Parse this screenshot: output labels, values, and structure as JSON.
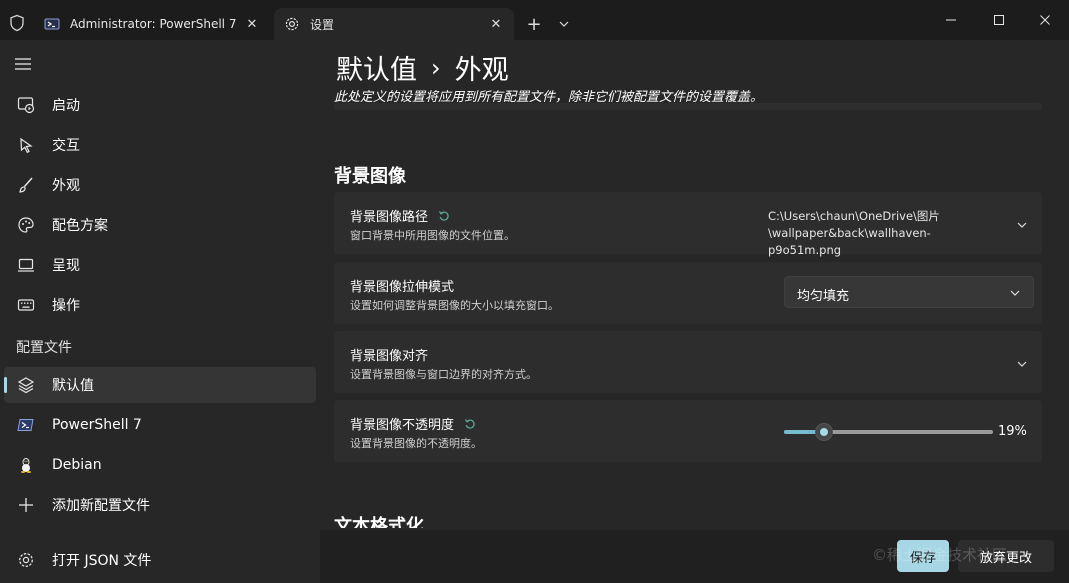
{
  "tabs": [
    {
      "label": "Administrator: PowerShell 7",
      "icon": "powershell-icon"
    },
    {
      "label": "设置",
      "icon": "gear-icon"
    }
  ],
  "sidebar": {
    "items": [
      {
        "label": "启动",
        "icon": "startup-icon"
      },
      {
        "label": "交互",
        "icon": "cursor-icon"
      },
      {
        "label": "外观",
        "icon": "brush-icon"
      },
      {
        "label": "配色方案",
        "icon": "palette-icon"
      },
      {
        "label": "呈现",
        "icon": "monitor-icon"
      },
      {
        "label": "操作",
        "icon": "keyboard-icon"
      }
    ],
    "profiles_header": "配置文件",
    "profiles": [
      {
        "label": "默认值",
        "icon": "layers-icon",
        "selected": true
      },
      {
        "label": "PowerShell 7",
        "icon": "powershell-icon"
      },
      {
        "label": "Debian",
        "icon": "linux-icon"
      },
      {
        "label": "添加新配置文件",
        "icon": "plus-icon"
      }
    ],
    "open_json": {
      "label": "打开 JSON 文件",
      "icon": "gear-icon"
    }
  },
  "main": {
    "breadcrumb": [
      "默认值",
      "外观"
    ],
    "breadcrumb_sep": "›",
    "subtitle": "此处定义的设置将应用到所有配置文件，除非它们被配置文件的设置覆盖。",
    "section_title": "背景图像",
    "cards": [
      {
        "title": "背景图像路径",
        "desc": "窗口背景中所用图像的文件位置。",
        "value_line1": "C:\\Users\\chaun\\OneDrive\\图片",
        "value_line2": "\\wallpaper&back\\wallhaven-p9o51m.png"
      },
      {
        "title": "背景图像拉伸模式",
        "desc": "设置如何调整背景图像的大小以填充窗口。",
        "dropdown_value": "均匀填充"
      },
      {
        "title": "背景图像对齐",
        "desc": "设置背景图像与窗口边界的对齐方式。"
      },
      {
        "title": "背景图像不透明度",
        "desc": "设置背景图像的不透明度。",
        "slider_value": 0.19,
        "slider_label": "19%"
      }
    ],
    "next_section": "文本格式化"
  },
  "footer": {
    "save_label": "保存",
    "discard_label": "放弃更改",
    "watermark": "©稀土掘金技术社区"
  },
  "colors": {
    "accent": "#a7d7e5",
    "slider_fill": "#76b9cc",
    "reset_icon": "#5fa89a"
  }
}
